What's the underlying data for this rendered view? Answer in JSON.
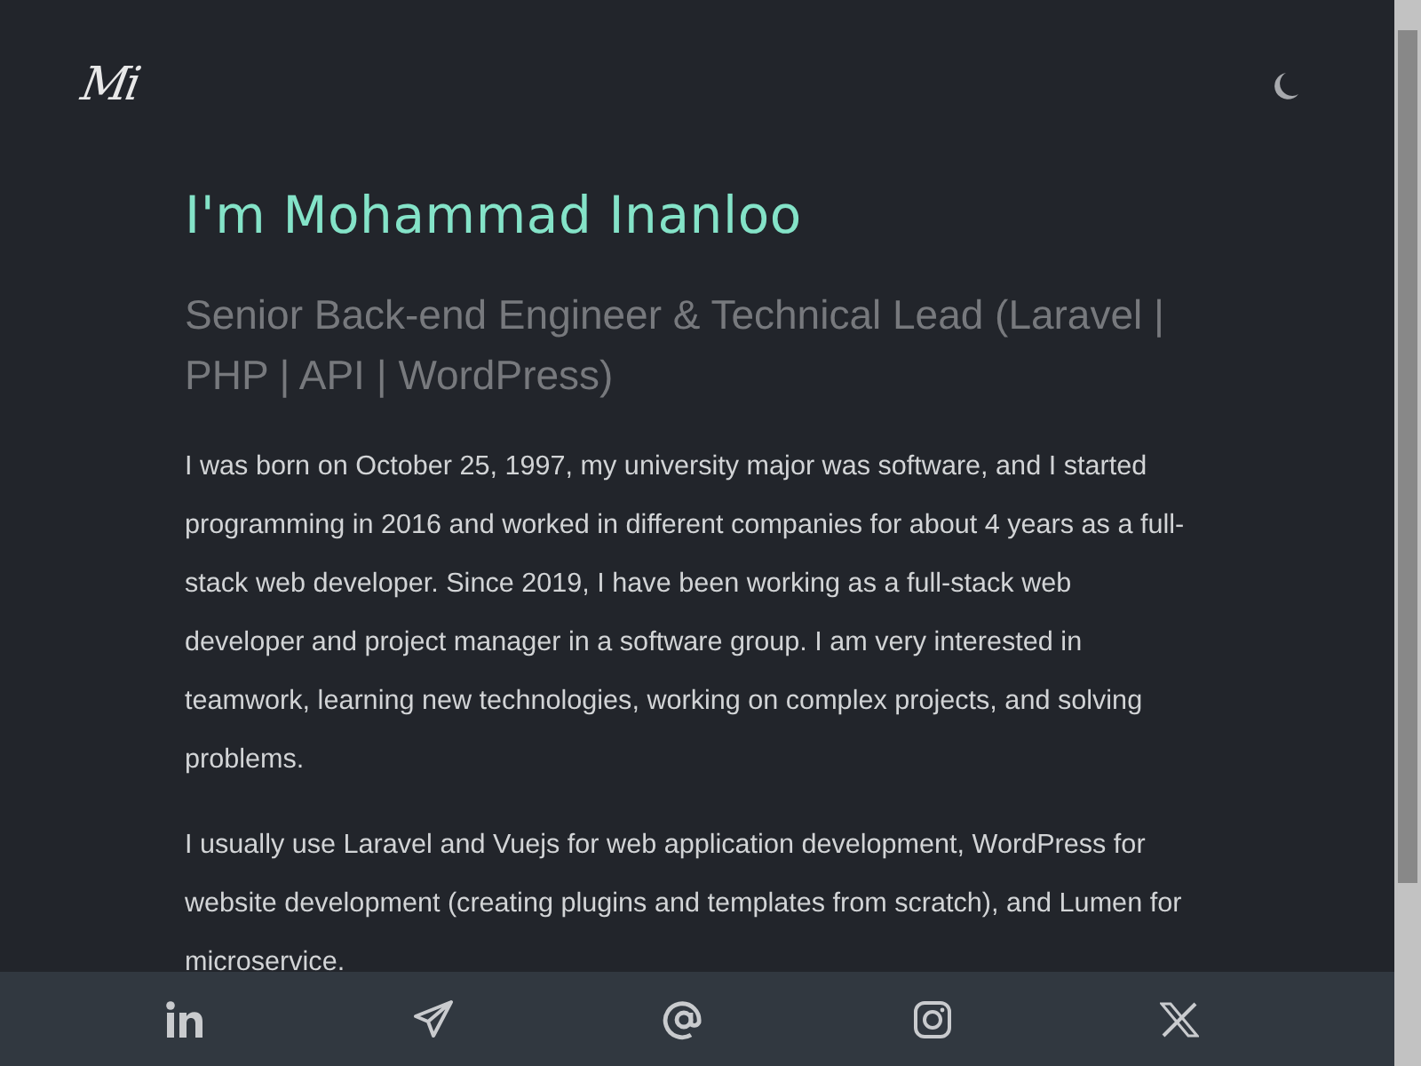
{
  "header": {
    "logo": "Mi"
  },
  "intro": {
    "title": "I'm Mohammad Inanloo",
    "subtitle": "Senior Back-end Engineer & Technical Lead (Laravel | PHP | API | WordPress)",
    "paragraphs": [
      "I was born on October 25, 1997, my university major was software, and I started programming in 2016 and worked in different companies for about 4 years as a full-stack web developer. Since 2019, I have been working as a full-stack web developer and project manager in a software group. I am very interested in teamwork, learning new technologies, working on complex projects, and solving problems.",
      "I usually use Laravel and Vuejs for web application development, WordPress for website development (creating plugins and templates from scratch), and Lumen for microservice."
    ]
  },
  "social": [
    {
      "kind": "linkedin"
    },
    {
      "kind": "telegram"
    },
    {
      "kind": "email"
    },
    {
      "kind": "instagram"
    },
    {
      "kind": "x"
    }
  ]
}
